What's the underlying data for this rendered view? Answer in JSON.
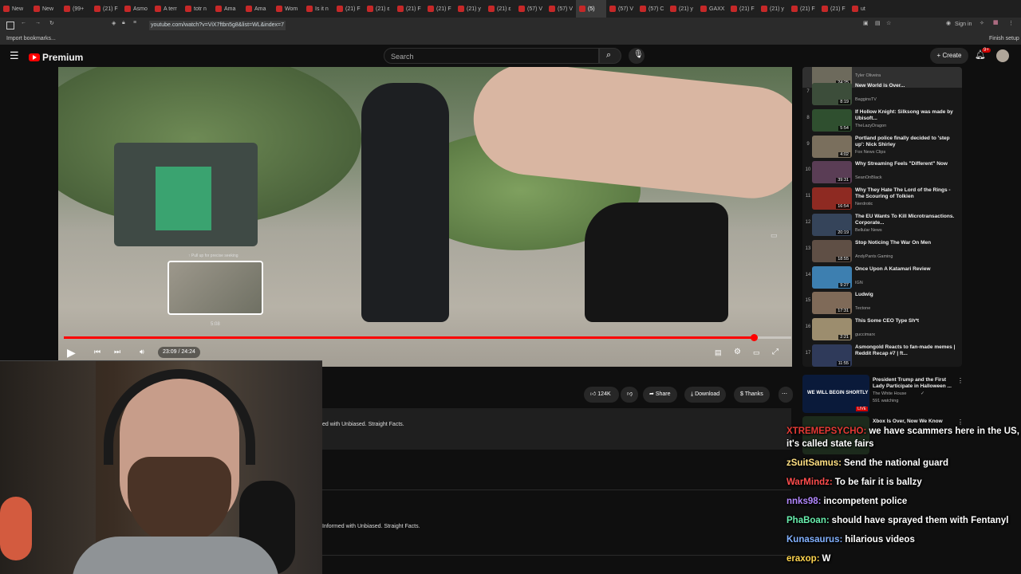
{
  "browser": {
    "tabs": [
      "New",
      "New",
      "(99+",
      "(21) F",
      "Asmo",
      "A terr",
      "totr n",
      "Ama",
      "Ama",
      "Wom",
      "Is it n",
      "(21) F",
      "(21) ε",
      "(21) F",
      "(21) F",
      "(21) y",
      "(21) ε",
      "(57) V",
      "(57) V",
      "(5)",
      "(57) V",
      "(57) C",
      "(21) y",
      "GAXX",
      "(21) F",
      "(21) y",
      "(21) F",
      "(21) F",
      "ut"
    ],
    "url": "youtube.com/watch?v=ViX7ftbn5g8&list=WL&index=7",
    "bookmark_label": "Import bookmarks...",
    "finish_setup": "Finish setup",
    "sign_in": "Sign in"
  },
  "youtube": {
    "logo_text": "Premium",
    "search_placeholder": "Search",
    "create_label": "Create",
    "notification_count": "9+"
  },
  "player": {
    "time": "23:09 / 24:24",
    "progress": 0.9487,
    "scrub_hint": "↑ Pull up for precise seeking",
    "scrub_time": "5:08"
  },
  "actions": {
    "likes": "124K",
    "share": "Share",
    "download": "Download",
    "thanks": "Thanks"
  },
  "description_snippets": [
    "ed with Unbiased. Straight Facts.",
    "Informed with Unbiased. Straight Facts."
  ],
  "playlist": {
    "partial_top": {
      "title": "...",
      "channel": "Tyler Oliveira",
      "duration": "24:25"
    },
    "items": [
      {
        "num": "7",
        "title": "New World is Over...",
        "channel": "BagginsTV",
        "duration": "8:19"
      },
      {
        "num": "8",
        "title": "If Hollow Knight: Silksong was made by Ubisoft...",
        "channel": "TheLazyDragon",
        "duration": "5:54"
      },
      {
        "num": "9",
        "title": "Portland police finally decided to 'step up': Nick Shirley",
        "channel": "Fox News Clips",
        "duration": "4:02"
      },
      {
        "num": "10",
        "title": "Why Streaming Feels \"Different\" Now",
        "channel": "SeanOnBlack",
        "duration": "39:31"
      },
      {
        "num": "11",
        "title": "Why They Hate The Lord of the Rings - The Scouring of Tolkien",
        "channel": "Nerdrotic",
        "duration": "16:54"
      },
      {
        "num": "12",
        "title": "The EU Wants To Kill Microtransactions. Corporate...",
        "channel": "Bellular News",
        "duration": "20:19"
      },
      {
        "num": "13",
        "title": "Stop Noticing The War On Men",
        "channel": "AndyPants Gaming",
        "duration": "18:55"
      },
      {
        "num": "14",
        "title": "Once Upon A Katamari Review",
        "channel": "IGN",
        "duration": "9:27"
      },
      {
        "num": "15",
        "title": "Ludwig",
        "channel": "Tectone",
        "duration": "17:31"
      },
      {
        "num": "16",
        "title": "This Some CEO Type Sh*t",
        "channel": "guccimarx",
        "duration": "2:21"
      },
      {
        "num": "17",
        "title": "Asmongold Reacts to fan-made memes | Reddit Recap #7 | ft...",
        "channel": "",
        "duration": "11:55"
      }
    ]
  },
  "recommendations": [
    {
      "title": "President Trump and the First Lady Participate in Halloween ...",
      "channel": "The White House",
      "meta": "591 watching",
      "badge": "LIVE",
      "thumb_text": "WE WILL BEGIN SHORTLY"
    },
    {
      "title": "Xbox Is Over, Now We Know",
      "channel": "",
      "meta": "",
      "badge": "",
      "thumb_text": ""
    }
  ],
  "chat": [
    {
      "user": "XTREMEPSYCHO:",
      "color": "#e53935",
      "text": "we have scammers here in the US, it's called state fairs"
    },
    {
      "user": "zSuitSamus:",
      "color": "#ffe082",
      "text": "Send the national guard"
    },
    {
      "user": "WarMindz:",
      "color": "#ff4d4d",
      "text": "To be fair it is ballzy"
    },
    {
      "user": "nnks98:",
      "color": "#b388ff",
      "text": "incompetent police"
    },
    {
      "user": "PhaBoan:",
      "color": "#69f0ae",
      "text": "should have sprayed them with Fentanyl"
    },
    {
      "user": "Kunasaurus:",
      "color": "#82b1ff",
      "text": "hilarious videos"
    },
    {
      "user": "eraxop:",
      "color": "#ffd54f",
      "text": "W"
    }
  ],
  "colors": {
    "accent": "#ff0000",
    "bg": "#0f0f0f"
  }
}
